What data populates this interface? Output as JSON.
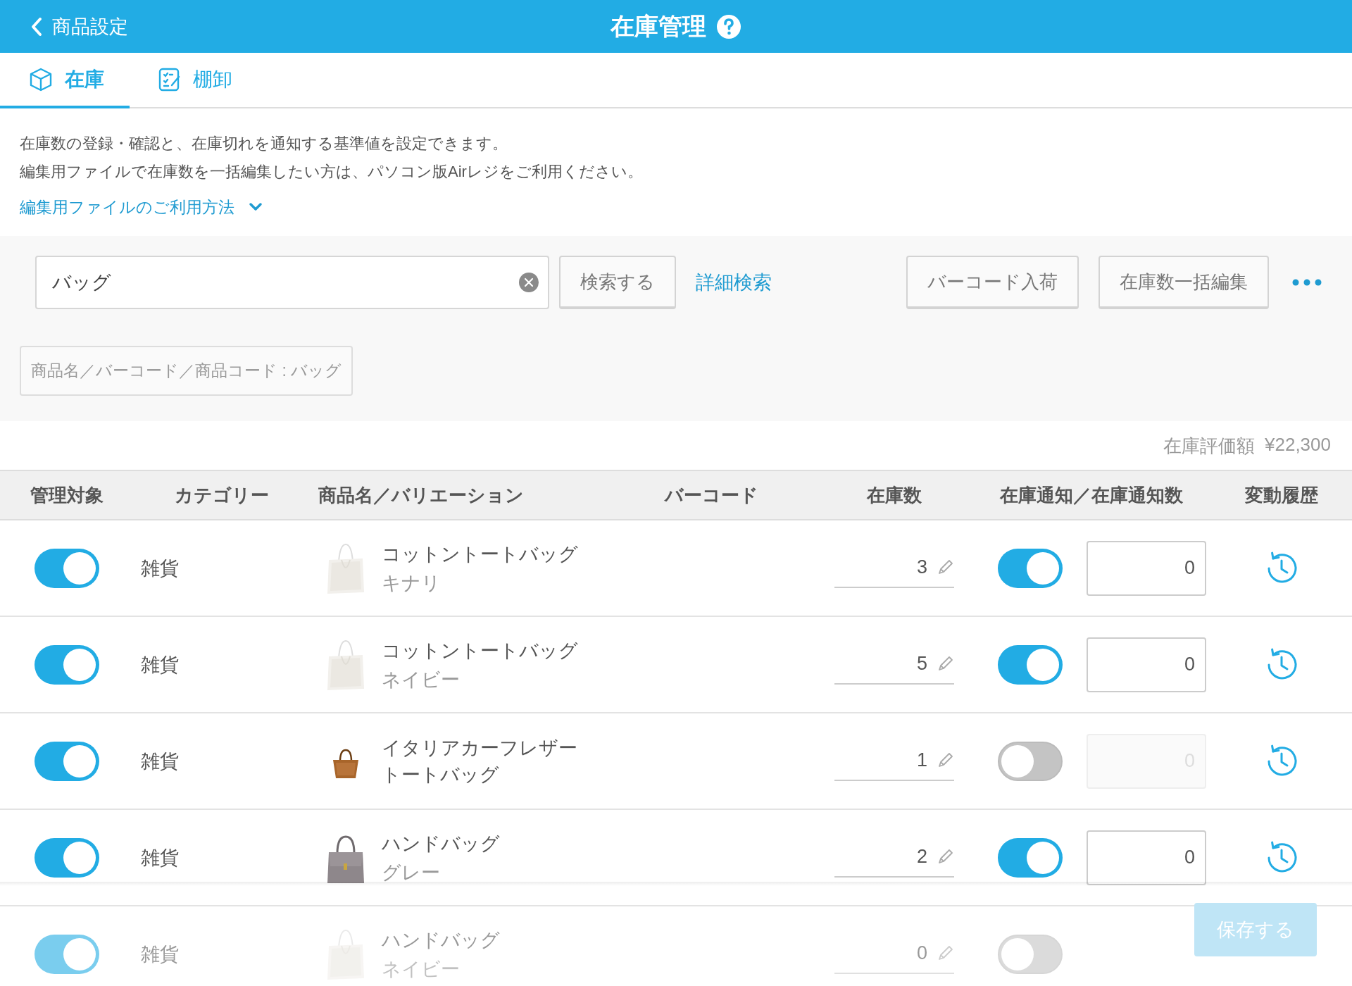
{
  "header": {
    "back_label": "商品設定",
    "title": "在庫管理"
  },
  "tabs": [
    {
      "label": "在庫",
      "selected": true
    },
    {
      "label": "棚卸",
      "selected": false
    }
  ],
  "description": [
    "在庫数の登録・確認と、在庫切れを通知する基準値を設定できます。",
    "編集用ファイルで在庫数を一括編集したい方は、パソコン版Airレジをご利用ください。"
  ],
  "help_link": "編集用ファイルのご利用方法",
  "search": {
    "value": "バッグ",
    "search_button": "検索する",
    "advanced_link": "詳細検索",
    "actions": [
      "バーコード入荷",
      "在庫数一括編集"
    ],
    "filter_chip": "商品名／バーコード／商品コード : バッグ"
  },
  "total": {
    "label": "在庫評価額",
    "value": "¥22,300"
  },
  "table": {
    "columns": [
      "管理対象",
      "カテゴリー",
      "商品名／バリエーション",
      "バーコード",
      "在庫数",
      "在庫通知／在庫通知数",
      "変動履歴"
    ],
    "rows": [
      {
        "managed": true,
        "category": "雑貨",
        "name": "コットントートバッグ",
        "variation": "キナリ",
        "kind": "tote",
        "stock": "3",
        "notify": true,
        "notify_count": "0"
      },
      {
        "managed": true,
        "category": "雑貨",
        "name": "コットントートバッグ",
        "variation": "ネイビー",
        "kind": "tote",
        "stock": "5",
        "notify": true,
        "notify_count": "0"
      },
      {
        "managed": true,
        "category": "雑貨",
        "name": "イタリアカーフレザートートバッグ",
        "kind": "leather",
        "stock": "1",
        "notify": false,
        "notify_count": "0"
      },
      {
        "managed": true,
        "category": "雑貨",
        "name": "ハンドバッグ",
        "variation": "グレー",
        "kind": "handbag",
        "stock": "2",
        "notify": true,
        "notify_count": "0"
      },
      {
        "managed": true,
        "category": "雑貨",
        "name": "ハンドバッグ",
        "variation": "ネイビー",
        "kind": "tote",
        "stock": "0",
        "notify": false
      }
    ]
  },
  "footer": {
    "save_button": "保存する",
    "disabled": true
  }
}
